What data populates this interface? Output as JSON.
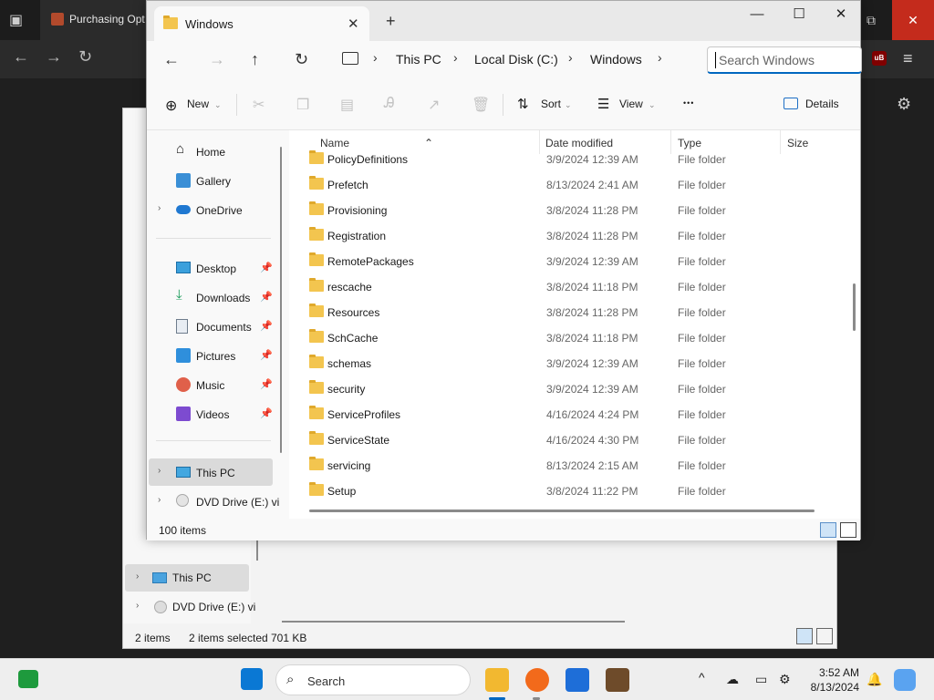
{
  "background_browser": {
    "tab_title": "Purchasing Opt",
    "close_symbol": "✕",
    "restore_symbol": "⧉",
    "ublock": "uB",
    "menu_symbol": "≡",
    "gear_symbol": "⚙"
  },
  "window": {
    "tab_title": "Windows",
    "tab_close": "✕",
    "new_tab": "+",
    "minimize": "—",
    "maximize": "☐",
    "close": "✕"
  },
  "address": {
    "back": "←",
    "forward": "→",
    "up": "↑",
    "refresh": "↻",
    "breadcrumbs": [
      "This PC",
      "Local Disk (C:)",
      "Windows"
    ],
    "separator": "›",
    "search_placeholder": "Search Windows"
  },
  "commands": {
    "new_label": "New",
    "sort_label": "Sort",
    "view_label": "View",
    "more_label": "•••",
    "details_label": "Details"
  },
  "nav": {
    "items": [
      {
        "label": "Home"
      },
      {
        "label": "Gallery"
      },
      {
        "label": "OneDrive"
      },
      {
        "label": "Desktop"
      },
      {
        "label": "Downloads"
      },
      {
        "label": "Documents"
      },
      {
        "label": "Pictures"
      },
      {
        "label": "Music"
      },
      {
        "label": "Videos"
      },
      {
        "label": "This PC"
      },
      {
        "label": "DVD Drive (E:) vi"
      }
    ]
  },
  "columns": {
    "name": "Name",
    "date": "Date modified",
    "type": "Type",
    "size": "Size"
  },
  "files": [
    {
      "name": "PolicyDefinitions",
      "date": "3/9/2024 12:39 AM",
      "type": "File folder"
    },
    {
      "name": "Prefetch",
      "date": "8/13/2024 2:41 AM",
      "type": "File folder"
    },
    {
      "name": "Provisioning",
      "date": "3/8/2024 11:28 PM",
      "type": "File folder"
    },
    {
      "name": "Registration",
      "date": "3/8/2024 11:28 PM",
      "type": "File folder"
    },
    {
      "name": "RemotePackages",
      "date": "3/9/2024 12:39 AM",
      "type": "File folder"
    },
    {
      "name": "rescache",
      "date": "3/8/2024 11:18 PM",
      "type": "File folder"
    },
    {
      "name": "Resources",
      "date": "3/8/2024 11:28 PM",
      "type": "File folder"
    },
    {
      "name": "SchCache",
      "date": "3/8/2024 11:18 PM",
      "type": "File folder"
    },
    {
      "name": "schemas",
      "date": "3/9/2024 12:39 AM",
      "type": "File folder"
    },
    {
      "name": "security",
      "date": "3/9/2024 12:39 AM",
      "type": "File folder"
    },
    {
      "name": "ServiceProfiles",
      "date": "4/16/2024 4:24 PM",
      "type": "File folder"
    },
    {
      "name": "ServiceState",
      "date": "4/16/2024 4:30 PM",
      "type": "File folder"
    },
    {
      "name": "servicing",
      "date": "8/13/2024 2:15 AM",
      "type": "File folder"
    },
    {
      "name": "Setup",
      "date": "3/8/2024 11:22 PM",
      "type": "File folder"
    }
  ],
  "status": {
    "item_count": "100 items"
  },
  "explorer2": {
    "this_pc": "This PC",
    "dvd": "DVD Drive (E:) vi",
    "items": "2 items",
    "selected": "2 items selected",
    "size": "701 KB"
  },
  "taskbar": {
    "search_label": "Search",
    "time": "3:52 AM",
    "date": "8/13/2024",
    "chevron": "^"
  }
}
